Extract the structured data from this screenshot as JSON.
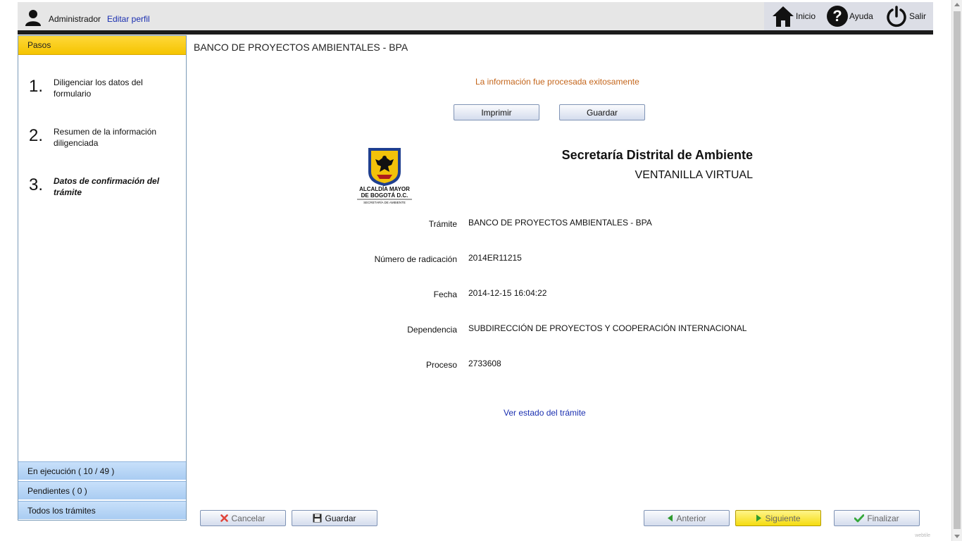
{
  "header": {
    "user_name": "Administrador",
    "edit_profile": "Editar perfil",
    "nav": {
      "home": "Inicio",
      "help": "Ayuda",
      "logout": "Salir"
    }
  },
  "sidebar": {
    "title": "Pasos",
    "steps": [
      {
        "number": "1.",
        "label": "Diligenciar los datos del formulario"
      },
      {
        "number": "2.",
        "label": "Resumen de la información diligenciada"
      },
      {
        "number": "3.",
        "label": "Datos de confirmación del trámite"
      }
    ],
    "sections": {
      "in_progress": "En ejecución ( 10 / 49 )",
      "pending": "Pendientes ( 0 )",
      "all": "Todos los trámites"
    }
  },
  "main": {
    "page_title": "BANCO DE PROYECTOS AMBIENTALES - BPA",
    "success_message": "La información fue procesada exitosamente",
    "print_button": "Imprimir",
    "save_button": "Guardar",
    "logo": {
      "line1": "ALCALDÍA MAYOR",
      "line2": "DE BOGOTÁ D.C.",
      "line3": "SECRETARÍA DE AMBIENTE"
    },
    "org_title": "Secretaría Distrital de Ambiente",
    "org_subtitle": "VENTANILLA VIRTUAL",
    "fields": [
      {
        "label": "Trámite",
        "value": "BANCO DE PROYECTOS AMBIENTALES - BPA"
      },
      {
        "label": "Número de radicación",
        "value": "2014ER11215"
      },
      {
        "label": "Fecha",
        "value": "2014-12-15 16:04:22"
      },
      {
        "label": "Dependencia",
        "value": "SUBDIRECCIÓN DE PROYECTOS Y COOPERACIÓN INTERNACIONAL"
      },
      {
        "label": "Proceso",
        "value": "2733608"
      }
    ],
    "status_link": "Ver estado del trámite"
  },
  "footer": {
    "cancel": "Cancelar",
    "save": "Guardar",
    "previous": "Anterior",
    "next": "Siguiente",
    "finish": "Finalizar"
  },
  "watermark": "webtile",
  "colors": {
    "accent_yellow": "#f5c400",
    "section_blue": "#a9ccf2",
    "link_blue": "#1a2fb0",
    "success_orange": "#c4661c"
  }
}
